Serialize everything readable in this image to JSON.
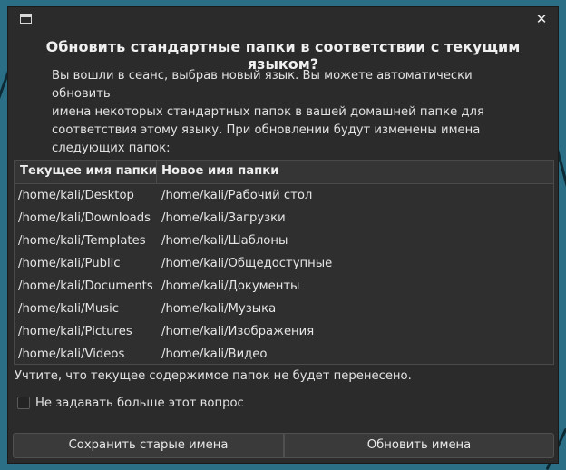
{
  "dialog": {
    "heading": "Обновить стандартные папки в соответствии с текущим языком?",
    "description": "Вы вошли в сеанс, выбрав новый язык. Вы можете автоматически обновить\nимена некоторых стандартных папок в вашей домашней папке для\nсоответствия этому языку. При обновлении будут изменены имена\nследующих папок:",
    "close_icon": "close-icon",
    "window_icon": "window-icon"
  },
  "table": {
    "columns": [
      "Текущее имя папки",
      "Новое имя папки"
    ],
    "rows": [
      [
        "/home/kali/Desktop",
        "/home/kali/Рабочий стол"
      ],
      [
        "/home/kali/Downloads",
        "/home/kali/Загрузки"
      ],
      [
        "/home/kali/Templates",
        "/home/kali/Шаблоны"
      ],
      [
        "/home/kali/Public",
        "/home/kali/Общедоступные"
      ],
      [
        "/home/kali/Documents",
        "/home/kali/Документы"
      ],
      [
        "/home/kali/Music",
        "/home/kali/Музыка"
      ],
      [
        "/home/kali/Pictures",
        "/home/kali/Изображения"
      ],
      [
        "/home/kali/Videos",
        "/home/kali/Видео"
      ]
    ]
  },
  "note": "Учтите, что текущее содержимое папок не будет перенесено.",
  "checkbox": {
    "label": "Не задавать больше этот вопрос",
    "checked": false
  },
  "buttons": {
    "keep": "Сохранить старые имена",
    "update": "Обновить имена"
  },
  "colors": {
    "dialog_bg": "#2b2b2b",
    "desktop_bg": "#2a6f86",
    "text": "#e6e6e6"
  }
}
